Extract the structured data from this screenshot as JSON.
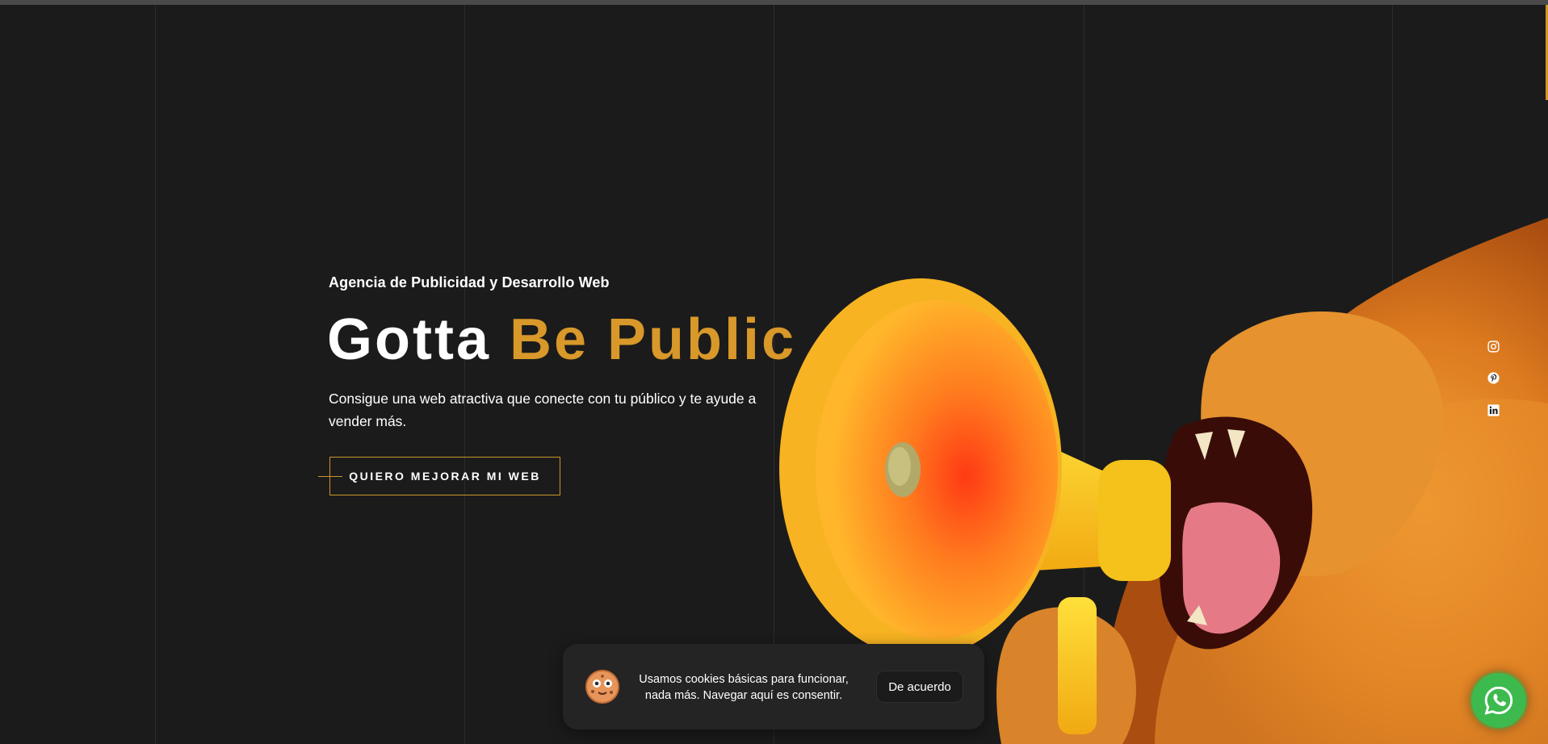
{
  "hero": {
    "eyebrow": "Agencia de Publicidad y Desarrollo Web",
    "headline_part1": "Gotta ",
    "headline_part2": "Be Public",
    "lead": "Consigue una web atractiva que conecte con tu público y te ayude a vender más.",
    "cta_label": "QUIERO MEJORAR MI WEB"
  },
  "social": [
    {
      "name": "instagram-icon"
    },
    {
      "name": "pinterest-icon"
    },
    {
      "name": "linkedin-icon"
    }
  ],
  "cookie_banner": {
    "message": "Usamos cookies básicas para funcionar, nada más. Navegar aquí es consentir.",
    "accept_label": "De acuerdo"
  },
  "whatsapp": {
    "icon": "whatsapp-icon"
  },
  "colors": {
    "background": "#1b1b1b",
    "accent": "#d8982a",
    "whatsapp": "#3dba4e"
  }
}
